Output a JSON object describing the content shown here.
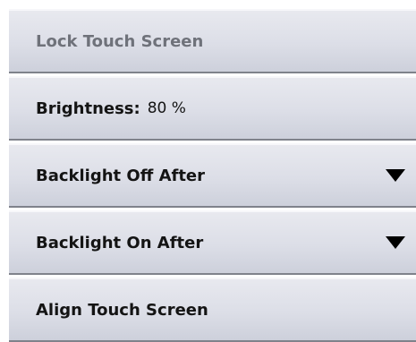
{
  "settings": {
    "lock_touch_screen": {
      "label": "Lock Touch Screen",
      "enabled": false
    },
    "brightness": {
      "label": "Brightness:",
      "value": "80 %"
    },
    "backlight_off_after": {
      "label": "Backlight Off After"
    },
    "backlight_on_after": {
      "label": "Backlight On After"
    },
    "align_touch_screen": {
      "label": "Align Touch Screen"
    }
  }
}
